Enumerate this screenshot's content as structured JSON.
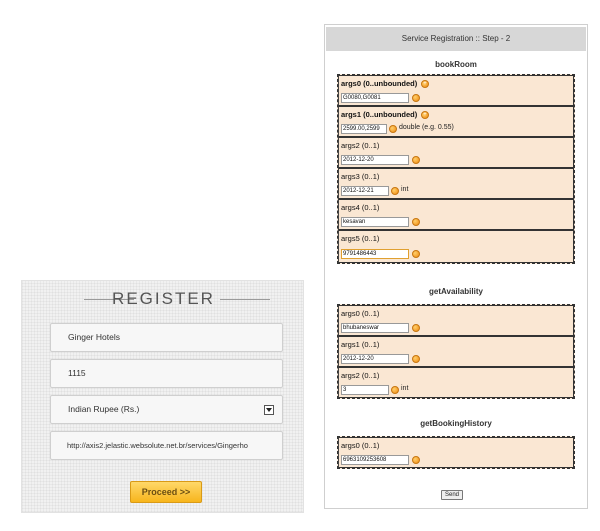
{
  "register": {
    "title": "REGISTER",
    "hotel_name": "Ginger Hotels",
    "hotel_id": "1115",
    "currency": "Indian Rupee (Rs.)",
    "service_url": "http://axis2.jelastic.websolute.net.br/services/Gingerho",
    "proceed_label": "Proceed >>"
  },
  "service": {
    "header": "Service Registration :: Step - 2",
    "send_label": "Send",
    "operations": [
      {
        "name": "bookRoom",
        "args": [
          {
            "name": "args0",
            "card": "(0..unbounded)",
            "value": "G0080,G0081",
            "type_hint": "",
            "add_button": "+"
          },
          {
            "name": "args1",
            "card": "(0..unbounded)",
            "value": "2599.00,2599",
            "type_hint": "double (e.g. 0.55)",
            "add_button": "+"
          },
          {
            "name": "args2",
            "card": "(0..1)",
            "value": "2012-12-20",
            "type_hint": "",
            "add_button": ""
          },
          {
            "name": "args3",
            "card": "(0..1)",
            "value": "2012-12-21",
            "type_hint": "int",
            "add_button": ""
          },
          {
            "name": "args4",
            "card": "(0..1)",
            "value": "kesavan",
            "type_hint": "",
            "add_button": ""
          },
          {
            "name": "args5",
            "card": "(0..1)",
            "value": "9791486443",
            "type_hint": "",
            "add_button": ""
          }
        ]
      },
      {
        "name": "getAvailability",
        "args": [
          {
            "name": "args0",
            "card": "(0..1)",
            "value": "bhubaneswar",
            "type_hint": "",
            "add_button": ""
          },
          {
            "name": "args1",
            "card": "(0..1)",
            "value": "2012-12-20",
            "type_hint": "",
            "add_button": ""
          },
          {
            "name": "args2",
            "card": "(0..1)",
            "value": "3",
            "type_hint": "int",
            "add_button": ""
          }
        ]
      },
      {
        "name": "getBookingHistory",
        "args": [
          {
            "name": "args0",
            "card": "(0..1)",
            "value": "6963109253608",
            "type_hint": "",
            "add_button": ""
          }
        ]
      }
    ]
  },
  "colors": {
    "arg_background": "#fae7d3",
    "header_background": "#d7d7d7",
    "proceed_button": "#f7b51c",
    "orange_icon": "#f08a10"
  }
}
